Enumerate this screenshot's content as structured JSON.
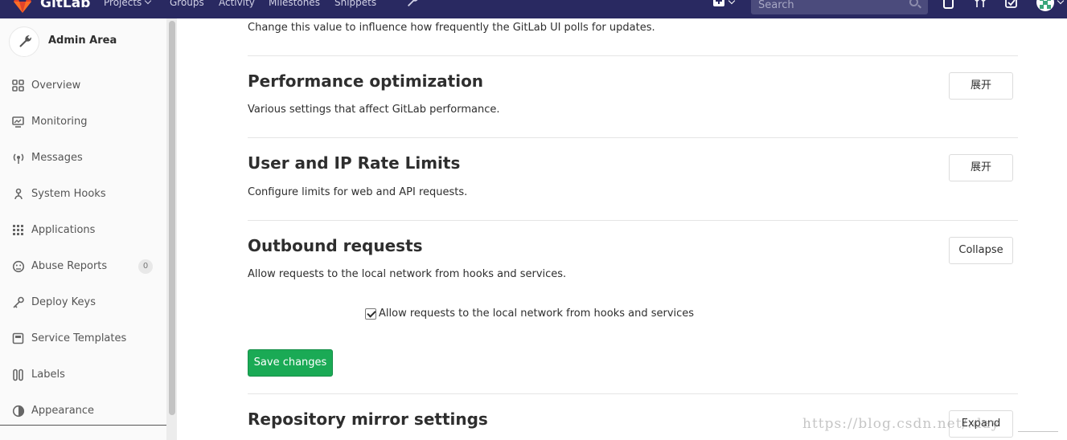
{
  "navbar": {
    "brand": "GitLab",
    "links": [
      {
        "label": "Projects",
        "has_dropdown": true
      },
      {
        "label": "Groups",
        "has_dropdown": false
      },
      {
        "label": "Activity",
        "has_dropdown": false
      },
      {
        "label": "Milestones",
        "has_dropdown": false
      },
      {
        "label": "Snippets",
        "has_dropdown": false
      }
    ],
    "search_placeholder": "Search",
    "icons": [
      "gitlab-logo-icon",
      "admin-wrench-icon",
      "new-plus-icon",
      "search-icon",
      "issues-icon",
      "merge-requests-icon",
      "todos-icon",
      "avatar"
    ],
    "bg_color": "#292961"
  },
  "sidebar": {
    "title": "Admin Area",
    "items": [
      {
        "label": "Overview",
        "icon": "overview-grid-icon"
      },
      {
        "label": "Monitoring",
        "icon": "monitor-icon"
      },
      {
        "label": "Messages",
        "icon": "broadcast-icon"
      },
      {
        "label": "System Hooks",
        "icon": "hook-icon"
      },
      {
        "label": "Applications",
        "icon": "apps-grid-icon"
      },
      {
        "label": "Abuse Reports",
        "icon": "abuse-icon",
        "badge": "0"
      },
      {
        "label": "Deploy Keys",
        "icon": "key-icon"
      },
      {
        "label": "Service Templates",
        "icon": "template-icon"
      },
      {
        "label": "Labels",
        "icon": "label-icon"
      },
      {
        "label": "Appearance",
        "icon": "appearance-icon"
      }
    ]
  },
  "main": {
    "top_description": "Change this value to influence how frequently the GitLab UI polls for updates.",
    "sections": [
      {
        "title": "Performance optimization",
        "description": "Various settings that affect GitLab performance.",
        "button": "展开"
      },
      {
        "title": "User and IP Rate Limits",
        "description": "Configure limits for web and API requests.",
        "button": "展开"
      },
      {
        "title": "Outbound requests",
        "description": "Allow requests to the local network from hooks and services.",
        "button": "Collapse"
      },
      {
        "title": "Repository mirror settings",
        "button": "Expand"
      }
    ],
    "checkbox_label": "Allow requests to the local network from hooks and services",
    "checkbox_checked": true,
    "save_label": "Save changes",
    "save_color": "#1aaa55"
  },
  "watermark": "https://blog.csdn.net/.day"
}
